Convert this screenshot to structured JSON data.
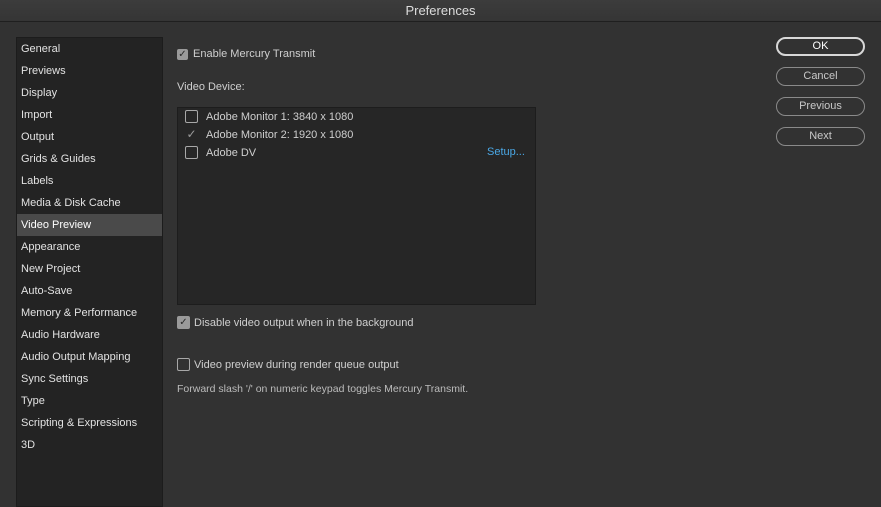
{
  "window": {
    "title": "Preferences"
  },
  "sidebar": {
    "items": [
      {
        "label": "General"
      },
      {
        "label": "Previews"
      },
      {
        "label": "Display"
      },
      {
        "label": "Import"
      },
      {
        "label": "Output"
      },
      {
        "label": "Grids & Guides"
      },
      {
        "label": "Labels"
      },
      {
        "label": "Media & Disk Cache"
      },
      {
        "label": "Video Preview"
      },
      {
        "label": "Appearance"
      },
      {
        "label": "New Project"
      },
      {
        "label": "Auto-Save"
      },
      {
        "label": "Memory & Performance"
      },
      {
        "label": "Audio Hardware"
      },
      {
        "label": "Audio Output Mapping"
      },
      {
        "label": "Sync Settings"
      },
      {
        "label": "Type"
      },
      {
        "label": "Scripting & Expressions"
      },
      {
        "label": "3D"
      }
    ],
    "selected": "Video Preview"
  },
  "panel": {
    "enable_mercury": {
      "label": "Enable Mercury Transmit",
      "checked": true
    },
    "video_device_label": "Video Device:",
    "devices": [
      {
        "label": "Adobe Monitor 1: 3840 x 1080",
        "checked": false
      },
      {
        "label": "Adobe Monitor 2: 1920 x 1080",
        "checked": true
      },
      {
        "label": "Adobe DV",
        "checked": false
      }
    ],
    "setup_link": "Setup...",
    "disable_bg": {
      "label": "Disable video output when in the background",
      "checked": true
    },
    "render_queue": {
      "label": "Video preview during render queue output",
      "checked": false
    },
    "hint": "Forward slash '/' on numeric keypad toggles Mercury Transmit."
  },
  "buttons": {
    "ok": "OK",
    "cancel": "Cancel",
    "previous": "Previous",
    "next": "Next"
  },
  "check_glyph": "✓"
}
